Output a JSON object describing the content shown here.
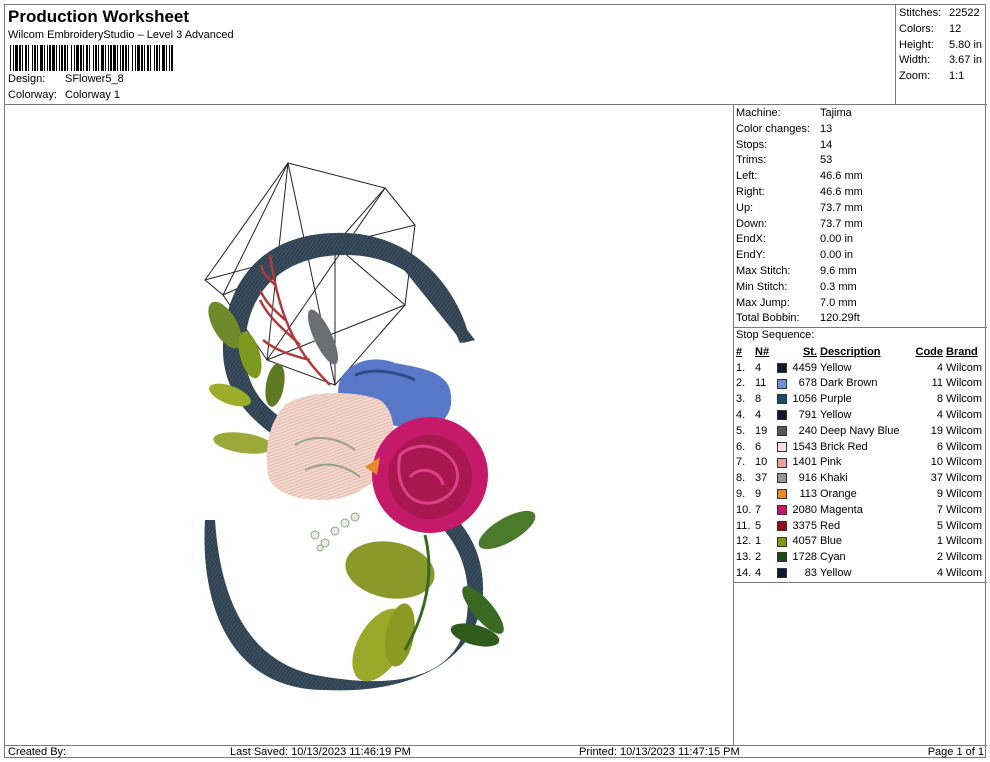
{
  "header": {
    "title": "Production Worksheet",
    "subtitle": "Wilcom EmbroideryStudio – Level 3 Advanced",
    "design_label": "Design:",
    "design_value": "SFlower5_8",
    "colorway_label": "Colorway:",
    "colorway_value": "Colorway 1"
  },
  "summary": [
    {
      "label": "Stitches:",
      "value": "22522"
    },
    {
      "label": "Colors:",
      "value": "12"
    },
    {
      "label": "Height:",
      "value": "5.80 in"
    },
    {
      "label": "Width:",
      "value": "3.67 in"
    },
    {
      "label": "Zoom:",
      "value": "1:1"
    }
  ],
  "stats": [
    {
      "label": "Machine:",
      "value": "Tajima"
    },
    {
      "label": "Color changes:",
      "value": "13"
    },
    {
      "label": "Stops:",
      "value": "14"
    },
    {
      "label": "Trims:",
      "value": "53"
    },
    {
      "label": "Left:",
      "value": "46.6 mm"
    },
    {
      "label": "Right:",
      "value": "46.6 mm"
    },
    {
      "label": "Up:",
      "value": "73.7 mm"
    },
    {
      "label": "Down:",
      "value": "73.7 mm"
    },
    {
      "label": "EndX:",
      "value": "0.00 in"
    },
    {
      "label": "EndY:",
      "value": "0.00 in"
    },
    {
      "label": "Max Stitch:",
      "value": "9.6 mm"
    },
    {
      "label": "Min Stitch:",
      "value": "0.3 mm"
    },
    {
      "label": "Max Jump:",
      "value": "7.0 mm"
    },
    {
      "label": "Total Bobbin:",
      "value": "120.29ft"
    }
  ],
  "stop_sequence": {
    "title": "Stop Sequence:",
    "columns": {
      "no": "#",
      "n": "N#",
      "st": "St.",
      "desc": "Description",
      "code": "Code",
      "brand": "Brand"
    },
    "rows": [
      {
        "no": "1.",
        "n": "4",
        "color": "#0d1a2b",
        "st": "4459",
        "desc": "Yellow",
        "code": "4",
        "brand": "Wilcom"
      },
      {
        "no": "2.",
        "n": "11",
        "color": "#6f8fe0",
        "st": "678",
        "desc": "Dark Brown",
        "code": "11",
        "brand": "Wilcom"
      },
      {
        "no": "3.",
        "n": "8",
        "color": "#1c4a6e",
        "st": "1056",
        "desc": "Purple",
        "code": "8",
        "brand": "Wilcom"
      },
      {
        "no": "4.",
        "n": "4",
        "color": "#0d1a2b",
        "st": "791",
        "desc": "Yellow",
        "code": "4",
        "brand": "Wilcom"
      },
      {
        "no": "5.",
        "n": "19",
        "color": "#555a60",
        "st": "240",
        "desc": "Deep Navy Blue",
        "code": "19",
        "brand": "Wilcom"
      },
      {
        "no": "6.",
        "n": "6",
        "color": "#f6e3dc",
        "st": "1543",
        "desc": "Brick Red",
        "code": "6",
        "brand": "Wilcom"
      },
      {
        "no": "7.",
        "n": "10",
        "color": "#e6a4a4",
        "st": "1401",
        "desc": "Pink",
        "code": "10",
        "brand": "Wilcom"
      },
      {
        "no": "8.",
        "n": "37",
        "color": "#9a9a8c",
        "st": "916",
        "desc": "Khaki",
        "code": "37",
        "brand": "Wilcom"
      },
      {
        "no": "9.",
        "n": "9",
        "color": "#e8892a",
        "st": "113",
        "desc": "Orange",
        "code": "9",
        "brand": "Wilcom"
      },
      {
        "no": "10.",
        "n": "7",
        "color": "#d0146e",
        "st": "2080",
        "desc": "Magenta",
        "code": "7",
        "brand": "Wilcom"
      },
      {
        "no": "11.",
        "n": "5",
        "color": "#8e0f18",
        "st": "3375",
        "desc": "Red",
        "code": "5",
        "brand": "Wilcom"
      },
      {
        "no": "12.",
        "n": "1",
        "color": "#7f9a1a",
        "st": "4057",
        "desc": "Blue",
        "code": "1",
        "brand": "Wilcom"
      },
      {
        "no": "13.",
        "n": "2",
        "color": "#1f4a1c",
        "st": "1728",
        "desc": "Cyan",
        "code": "2",
        "brand": "Wilcom"
      },
      {
        "no": "14.",
        "n": "4",
        "color": "#0d1a2b",
        "st": "83",
        "desc": "Yellow",
        "code": "4",
        "brand": "Wilcom"
      }
    ]
  },
  "footer": {
    "created_by": "Created By:",
    "last_saved": "Last Saved: 10/13/2023 11:46:19 PM",
    "printed": "Printed: 10/13/2023 11:47:15 PM",
    "page": "Page 1 of 1"
  }
}
